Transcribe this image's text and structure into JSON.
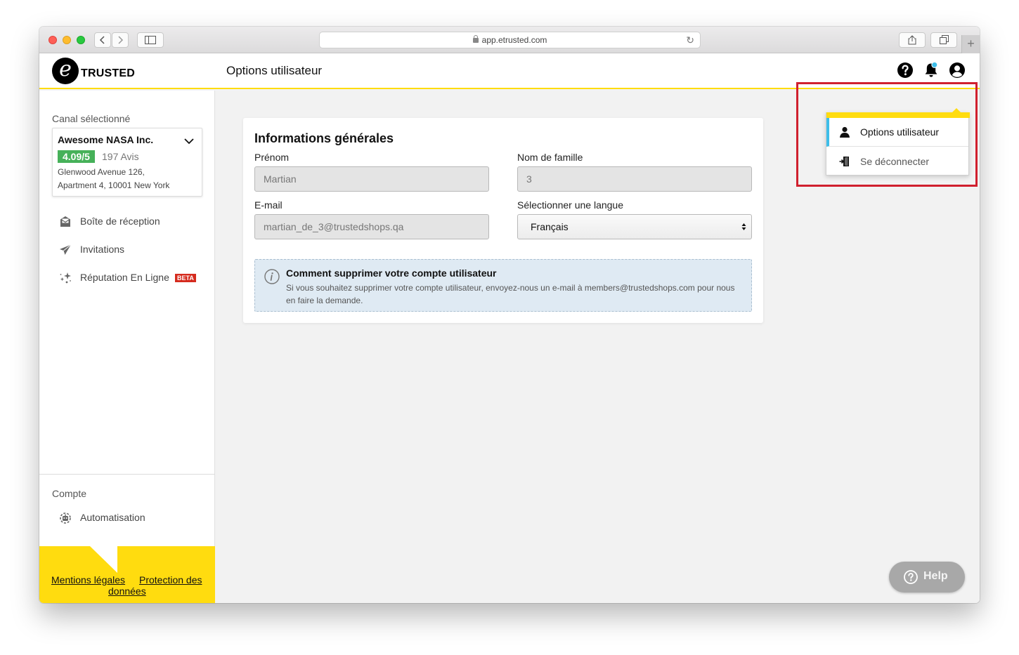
{
  "browser": {
    "url": "app.etrusted.com"
  },
  "header": {
    "logo_letter": "e",
    "logo_text": "TRUSTED",
    "page_title": "Options utilisateur",
    "notification_dot_color": "#3ebee9"
  },
  "sidebar": {
    "channel_label": "Canal sélectionné",
    "channel": {
      "name": "Awesome NASA Inc.",
      "rating": "4.09/5",
      "reviews": "197 Avis",
      "address_line1": "Glenwood Avenue 126,",
      "address_line2": "Apartment 4, 10001 New York"
    },
    "nav": [
      {
        "label": "Boîte de réception",
        "icon": "inbox-icon"
      },
      {
        "label": "Invitations",
        "icon": "paper-plane-icon"
      },
      {
        "label": "Réputation En Ligne",
        "icon": "sparkle-stars-icon",
        "badge": "BETA"
      }
    ],
    "account_label": "Compte",
    "account_nav": [
      {
        "label": "Automatisation",
        "icon": "robot-icon"
      }
    ],
    "footer": {
      "legal": "Mentions légales",
      "privacy_line1": "Protection des",
      "privacy_line2": "données"
    }
  },
  "main": {
    "card_title": "Informations générales",
    "first_name_label": "Prénom",
    "first_name_value": "Martian",
    "last_name_label": "Nom de famille",
    "last_name_value": "3",
    "email_label": "E-mail",
    "email_value": "martian_de_3@trustedshops.qa",
    "language_label": "Sélectionner une langue",
    "language_value": "Français",
    "info_title": "Comment supprimer votre compte utilisateur",
    "info_text": "Si vous souhaitez supprimer votre compte utilisateur, envoyez-nous un e-mail à members@trustedshops.com pour nous en faire la demande."
  },
  "user_menu": {
    "items": [
      {
        "label": "Options utilisateur",
        "icon": "user-icon",
        "active": true
      },
      {
        "label": "Se déconnecter",
        "icon": "logout-icon",
        "active": false
      }
    ]
  },
  "help_button": {
    "label": "Help"
  },
  "colors": {
    "brand_yellow": "#ffdc0f",
    "rating_green": "#46b159",
    "active_blue": "#3ebee9",
    "highlight_red": "#d0202e",
    "beta_red": "#d52b1e"
  }
}
